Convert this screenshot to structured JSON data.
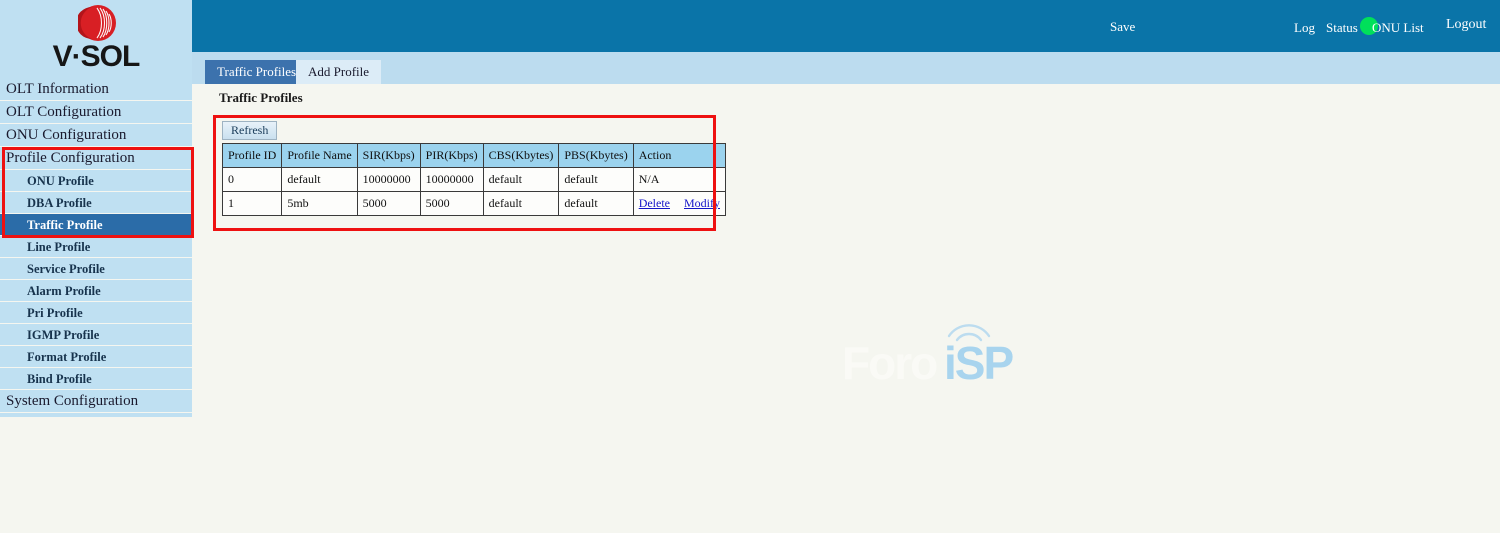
{
  "brand": {
    "logo_icon": "vsol-circle-logo",
    "wordmark": "V·SOL"
  },
  "header": {
    "save_label": "Save",
    "status_indicator_icon": "green-status-dot",
    "status_indicator_color": "#00e05a",
    "links": [
      {
        "label": "Log",
        "name": "log"
      },
      {
        "label": "Status",
        "name": "status"
      },
      {
        "label": "ONU List",
        "name": "onu-list"
      }
    ],
    "logout_label": "Logout",
    "bar_color": "#0a74a8"
  },
  "sidebar": {
    "background_color": "#bfe0f2",
    "highlight_color": "#ee1111",
    "active_color": "#2b6ca8",
    "top_items": [
      {
        "label": "OLT Information",
        "name": "olt-information"
      },
      {
        "label": "OLT Configuration",
        "name": "olt-configuration"
      },
      {
        "label": "ONU Configuration",
        "name": "onu-configuration"
      },
      {
        "label": "Profile Configuration",
        "name": "profile-configuration"
      }
    ],
    "profile_items": [
      {
        "label": "ONU Profile",
        "name": "onu-profile",
        "active": false
      },
      {
        "label": "DBA Profile",
        "name": "dba-profile",
        "active": false
      },
      {
        "label": "Traffic Profile",
        "name": "traffic-profile",
        "active": true
      },
      {
        "label": "Line Profile",
        "name": "line-profile",
        "active": false
      },
      {
        "label": "Service Profile",
        "name": "service-profile",
        "active": false
      },
      {
        "label": "Alarm Profile",
        "name": "alarm-profile",
        "active": false
      },
      {
        "label": "Pri Profile",
        "name": "pri-profile",
        "active": false
      },
      {
        "label": "IGMP Profile",
        "name": "igmp-profile",
        "active": false
      },
      {
        "label": "Format Profile",
        "name": "format-profile",
        "active": false
      },
      {
        "label": "Bind Profile",
        "name": "bind-profile",
        "active": false
      }
    ],
    "bottom_item": {
      "label": "System Configuration",
      "name": "system-configuration"
    }
  },
  "tabs": [
    {
      "label": "Traffic Profiles",
      "name": "traffic-profiles",
      "active": true
    },
    {
      "label": "Add Profile",
      "name": "add-profile",
      "active": false
    }
  ],
  "main": {
    "page_title": "Traffic Profiles",
    "refresh_label": "Refresh",
    "table": {
      "columns": [
        "Profile ID",
        "Profile Name",
        "SIR(Kbps)",
        "PIR(Kbps)",
        "CBS(Kbytes)",
        "PBS(Kbytes)",
        "Action"
      ],
      "rows": [
        {
          "profile_id": "0",
          "profile_name": "default",
          "sir": "10000000",
          "pir": "10000000",
          "cbs": "default",
          "pbs": "default",
          "action_text": "N/A",
          "has_links": false,
          "delete_label": "",
          "modify_label": ""
        },
        {
          "profile_id": "1",
          "profile_name": "5mb",
          "sir": "5000",
          "pir": "5000",
          "cbs": "default",
          "pbs": "default",
          "action_text": "",
          "has_links": true,
          "delete_label": "Delete",
          "modify_label": "Modify"
        }
      ]
    }
  },
  "watermark": {
    "text_left": "Foro",
    "text_right": "iSP",
    "icon": "antenna-tower-icon"
  }
}
